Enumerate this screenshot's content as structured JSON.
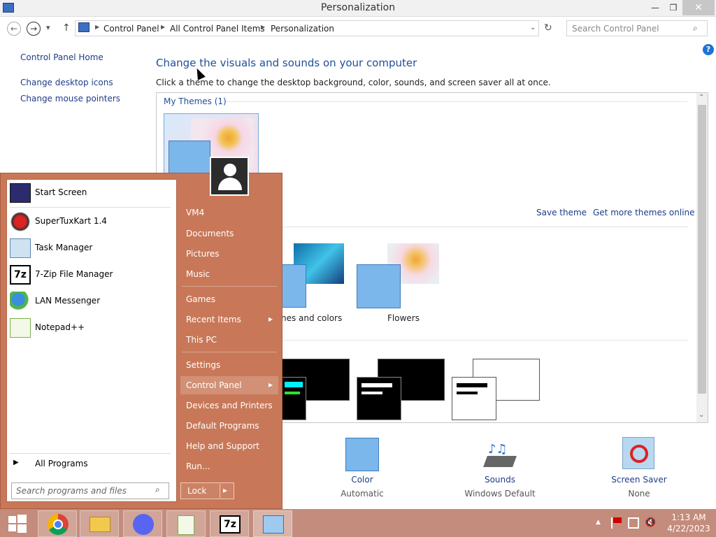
{
  "window": {
    "title": "Personalization",
    "minimize": "—",
    "restore": "❐",
    "close": "✕"
  },
  "nav": {
    "back": "←",
    "forward": "→",
    "recent": "▾",
    "up": "↑",
    "refresh": "↻"
  },
  "breadcrumb": [
    "Control Panel",
    "All Control Panel Items",
    "Personalization"
  ],
  "search": {
    "placeholder": "Search Control Panel"
  },
  "help": "?",
  "sidebar": {
    "home": "Control Panel Home",
    "items": [
      {
        "label": "Change desktop icons"
      },
      {
        "label": "Change mouse pointers"
      }
    ]
  },
  "main": {
    "heading": "Change the visuals and sounds on your computer",
    "subheading": "Click a theme to change the desktop background, color, sounds, and screen saver all at once.",
    "my_themes": "My Themes (1)",
    "save_theme": "Save theme",
    "get_more": "Get more themes online",
    "theme_labels": [
      "nes and colors",
      "Flowers"
    ]
  },
  "bottom": {
    "color": {
      "label": "Color",
      "sub": "Automatic"
    },
    "sounds": {
      "label": "Sounds",
      "sub": "Windows Default"
    },
    "screensaver": {
      "label": "Screen Saver",
      "sub": "None"
    }
  },
  "start_menu": {
    "user_name": "VM4",
    "programs": [
      {
        "label": "Start Screen",
        "icon": "start-screen-icon"
      },
      {
        "label": "SuperTuxKart 1.4",
        "icon": "kart-icon"
      },
      {
        "label": "Task Manager",
        "icon": "task-manager-icon"
      },
      {
        "label": "7-Zip File Manager",
        "icon": "7zip-icon"
      },
      {
        "label": "LAN Messenger",
        "icon": "messenger-icon"
      },
      {
        "label": "Notepad++",
        "icon": "notepad-icon"
      }
    ],
    "all_programs": "All Programs",
    "search_placeholder": "Search programs and files",
    "right": [
      "Documents",
      "Pictures",
      "Music",
      "Games",
      "Recent Items",
      "This PC",
      "Settings",
      "Control Panel",
      "Devices and Printers",
      "Default Programs",
      "Help and Support",
      "Run..."
    ],
    "lock": "Lock",
    "arrow": "▸"
  },
  "tray": {
    "time": "1:13 AM",
    "date": "4/22/2023"
  },
  "colors": {
    "accent": "#c87858",
    "link": "#1e3c88",
    "heading": "#1e4f9a"
  }
}
